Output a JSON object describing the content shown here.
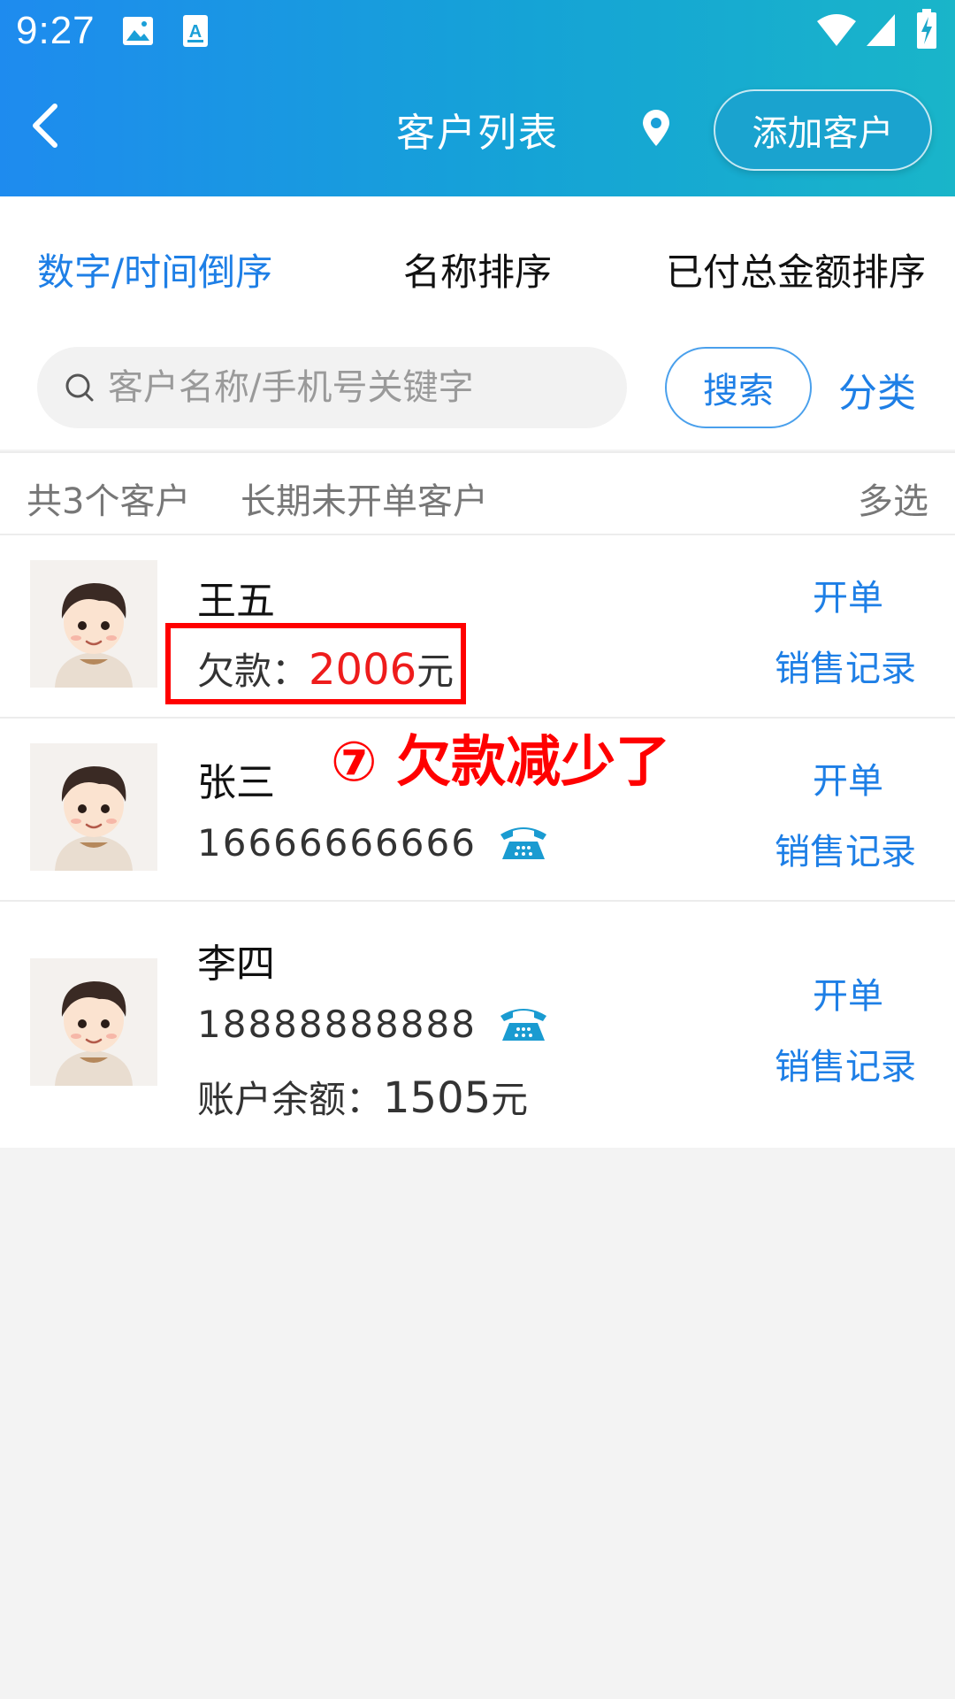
{
  "status_bar": {
    "time": "9:27"
  },
  "header": {
    "title": "客户列表",
    "add_button": "添加客户"
  },
  "sort_tabs": [
    {
      "label": "数字/时间倒序",
      "active": true
    },
    {
      "label": "名称排序",
      "active": false
    },
    {
      "label": "已付总金额排序",
      "active": false
    }
  ],
  "search": {
    "placeholder": "客户名称/手机号关键字",
    "button": "搜索",
    "category": "分类"
  },
  "summary": {
    "count": "共3个客户",
    "long_term": "长期未开单客户",
    "multi_select": "多选"
  },
  "customers": [
    {
      "name": "王五",
      "debt_label": "欠款：",
      "debt_value": "2006",
      "debt_unit": "元",
      "action_order": "开单",
      "action_sales": "销售记录"
    },
    {
      "name": "张三",
      "phone": "16666666666",
      "action_order": "开单",
      "action_sales": "销售记录"
    },
    {
      "name": "李四",
      "phone": "18888888888",
      "balance_label": "账户余额：",
      "balance_value": "1505",
      "balance_unit": "元",
      "action_order": "开单",
      "action_sales": "销售记录"
    }
  ],
  "annotation": {
    "text": "⑦ 欠款减少了"
  },
  "colors": {
    "accent": "#1e7fe6",
    "header_start": "#1e8bef",
    "header_end": "#19b5c9",
    "debt": "#ee1c1c",
    "annotation": "#ff0000",
    "phone_icon": "#1a9bd1"
  },
  "icons": [
    "back-icon",
    "image-icon",
    "a-icon",
    "wifi-icon",
    "signal-icon",
    "battery-icon",
    "location-pin-icon",
    "search-icon",
    "phone-icon"
  ]
}
